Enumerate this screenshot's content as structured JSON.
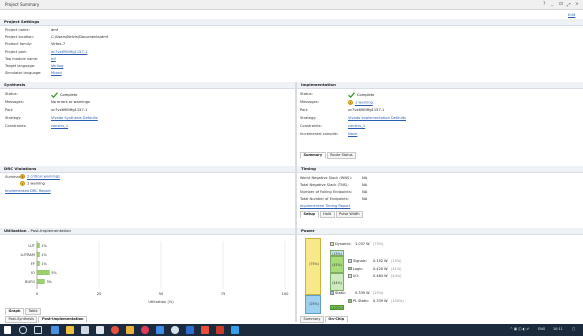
{
  "window": {
    "title": "Project Summary",
    "controls": "? _ ⊡ ⤢ ×",
    "edit_label": "Edit"
  },
  "project_settings": {
    "heading": "Project Settings",
    "rows": [
      {
        "label": "Project name:",
        "value": "dmf"
      },
      {
        "label": "Project location:",
        "value": "C:/Users/Kelvin/Documents/dmf"
      },
      {
        "label": "Product family:",
        "value": "Virtex-7"
      },
      {
        "label": "Project part:",
        "value": "xc7vx690tffg1157-1"
      },
      {
        "label": "Top module name:",
        "value": "mf"
      },
      {
        "label": "Target language:",
        "value": "Verilog"
      },
      {
        "label": "Simulator language:",
        "value": "Mixed"
      }
    ]
  },
  "synthesis": {
    "heading": "Synthesis",
    "rows": [
      {
        "label": "Status:",
        "value": "Complete"
      },
      {
        "label": "Messages:",
        "value": "No errors or warnings"
      },
      {
        "label": "Part:",
        "value": "xc7vx690tffg1157-1"
      },
      {
        "label": "Strategy:",
        "value": "Vivado Synthesis Defaults"
      },
      {
        "label": "Constraints:",
        "value": "constrs_1"
      }
    ]
  },
  "implementation": {
    "heading": "Implementation",
    "rows": [
      {
        "label": "Status:",
        "value": "Complete"
      },
      {
        "label": "Messages:",
        "value": "1 warning"
      },
      {
        "label": "Part:",
        "value": "xc7vx690tffg1157-1"
      },
      {
        "label": "Strategy:",
        "value": "Vivado Implementation Defaults"
      },
      {
        "label": "Constraints:",
        "value": "constrs_1"
      },
      {
        "label": "Incremental compile:",
        "value": "None"
      }
    ],
    "tabs": [
      "Summary",
      "Route Status"
    ]
  },
  "drc": {
    "heading": "DRC Violations",
    "summary_label": "Summary:",
    "critical": "2 critical warnings",
    "warning": "1 warning",
    "report_link": "Implemented DRC Report"
  },
  "timing": {
    "heading": "Timing",
    "rows": [
      {
        "label": "Worst Negative Slack (WNS):",
        "value": "NA"
      },
      {
        "label": "Total Negative Slack (TNS):",
        "value": "NA"
      },
      {
        "label": "Number of Failing Endpoints:",
        "value": "NA"
      },
      {
        "label": "Total Number of Endpoints:",
        "value": "NA"
      }
    ],
    "report_link": "Implemented Timing Report",
    "tabs": [
      "Setup",
      "Hold",
      "Pulse Width"
    ]
  },
  "utilization": {
    "heading": "Utilization",
    "subheading": "- Post-Implementation",
    "tabs": [
      "Graph",
      "Table"
    ],
    "bottom_tabs": [
      "Post-Synthesis",
      "Post-Implementation"
    ],
    "xlabel": "Utilization (%)"
  },
  "chart_data": {
    "type": "bar",
    "orientation": "horizontal",
    "categories": [
      "LUT",
      "LUTRAM",
      "FF",
      "IO",
      "BUFG"
    ],
    "values": [
      1,
      1,
      1,
      5,
      3
    ],
    "value_labels": [
      "1%",
      "1%",
      "1%",
      "5%",
      "3%"
    ],
    "xlabel": "Utilization (%)",
    "xlim": [
      0,
      100
    ],
    "xticks": [
      0,
      25,
      50,
      75,
      100
    ],
    "grid": true
  },
  "power": {
    "heading": "Power",
    "dynamic": {
      "label": "Dynamic:",
      "value": "1.037 W",
      "pct": "(75%)",
      "share": 75
    },
    "static": {
      "label": "Static:",
      "value": "0.339 W",
      "pct": "(25%)",
      "share": 25
    },
    "dynamic_parts": [
      {
        "label": "Signals:",
        "value": "0.152 W",
        "pct": "(15%)",
        "share": 15,
        "color": "#c6e4f2"
      },
      {
        "label": "Logic:",
        "value": "0.420 W",
        "pct": "(41%)",
        "share": 41,
        "color": "#a8dc7a"
      },
      {
        "label": "I/O:",
        "value": "0.464 W",
        "pct": "(44%)",
        "share": 44,
        "color": "#ccecc0"
      }
    ],
    "static_parts": [
      {
        "label": "PL Static:",
        "value": "0.339 W",
        "pct": "(100%)",
        "share": 100,
        "color": "#7dcb5a"
      }
    ],
    "tabs": [
      "Summary",
      "On-Chip"
    ],
    "colors": {
      "dynamic": "#f7e98a",
      "static": "#9fd0ef"
    }
  },
  "taskbar": {
    "tray_text": "ENG",
    "clock": "10:11"
  }
}
